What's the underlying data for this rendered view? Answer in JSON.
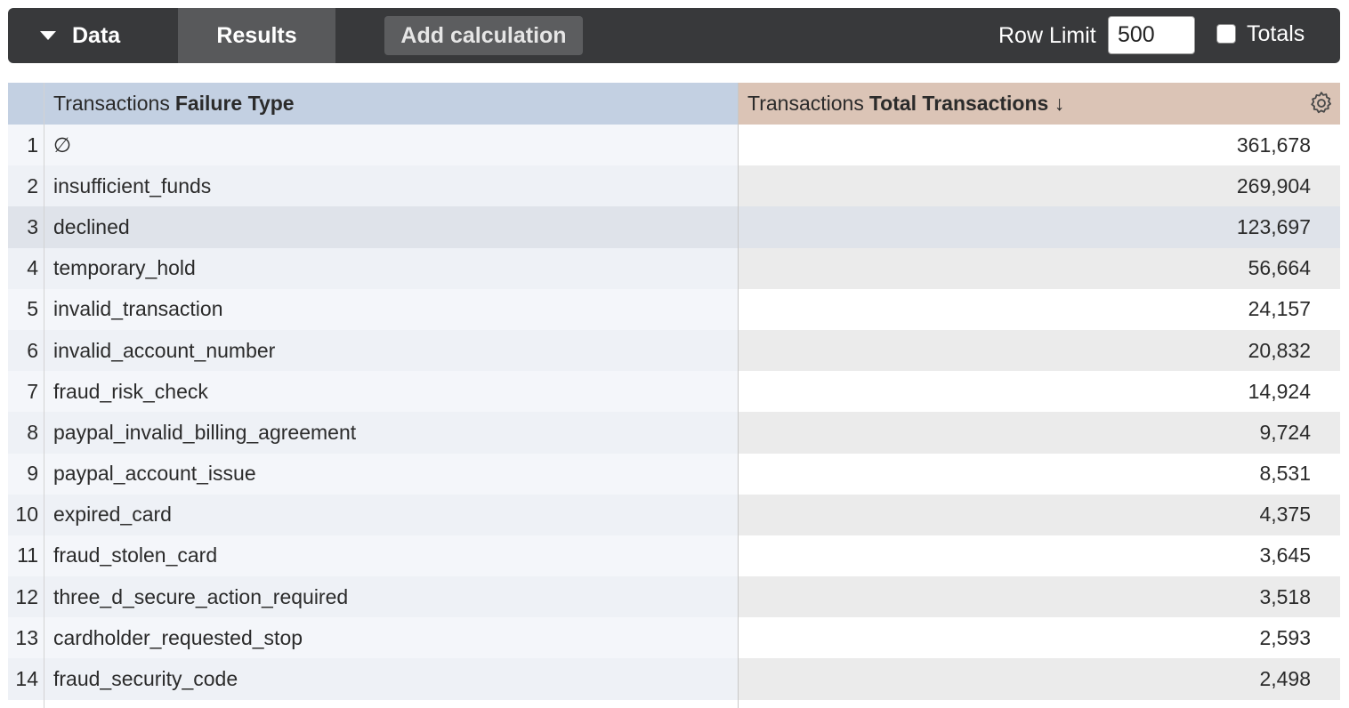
{
  "toolbar": {
    "data_tab": "Data",
    "results_tab": "Results",
    "add_calc": "Add calculation",
    "row_limit_label": "Row Limit",
    "row_limit_value": "500",
    "totals_label": "Totals"
  },
  "table": {
    "col1_prefix": "Transactions",
    "col1_name": "Failure Type",
    "col2_prefix": "Transactions",
    "col2_name": "Total Transactions ↓",
    "rows": [
      {
        "idx": "1",
        "type": "∅",
        "total": "361,678"
      },
      {
        "idx": "2",
        "type": "insufficient_funds",
        "total": "269,904"
      },
      {
        "idx": "3",
        "type": "declined",
        "total": "123,697"
      },
      {
        "idx": "4",
        "type": "temporary_hold",
        "total": "56,664"
      },
      {
        "idx": "5",
        "type": "invalid_transaction",
        "total": "24,157"
      },
      {
        "idx": "6",
        "type": "invalid_account_number",
        "total": "20,832"
      },
      {
        "idx": "7",
        "type": "fraud_risk_check",
        "total": "14,924"
      },
      {
        "idx": "8",
        "type": "paypal_invalid_billing_agreement",
        "total": "9,724"
      },
      {
        "idx": "9",
        "type": "paypal_account_issue",
        "total": "8,531"
      },
      {
        "idx": "10",
        "type": "expired_card",
        "total": "4,375"
      },
      {
        "idx": "11",
        "type": "fraud_stolen_card",
        "total": "3,645"
      },
      {
        "idx": "12",
        "type": "three_d_secure_action_required",
        "total": "3,518"
      },
      {
        "idx": "13",
        "type": "cardholder_requested_stop",
        "total": "2,593"
      },
      {
        "idx": "14",
        "type": "fraud_security_code",
        "total": "2,498"
      }
    ]
  }
}
